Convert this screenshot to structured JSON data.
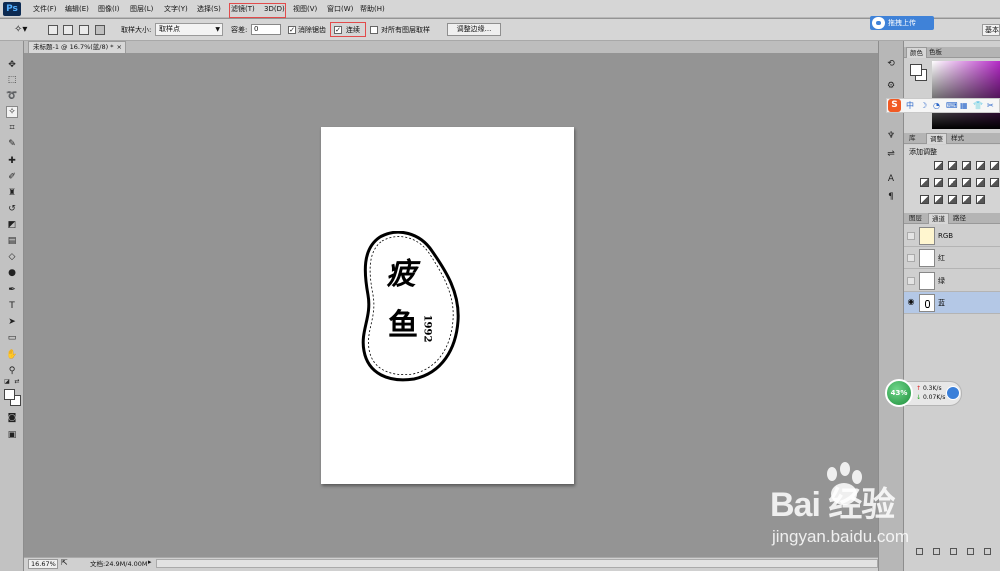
{
  "app": {
    "logo": "Ps"
  },
  "menu": [
    {
      "label": "文件(F)"
    },
    {
      "label": "编辑(E)"
    },
    {
      "label": "图像(I)"
    },
    {
      "label": "图层(L)"
    },
    {
      "label": "文字(Y)"
    },
    {
      "label": "选择(S)"
    },
    {
      "label": "滤镜(T)"
    },
    {
      "label": "3D(D)"
    },
    {
      "label": "视图(V)"
    },
    {
      "label": "窗口(W)"
    },
    {
      "label": "帮助(H)"
    }
  ],
  "upload_button": "拖拽上传",
  "options": {
    "sample_size_label": "取样大小:",
    "sample_size_value": "取样点",
    "tolerance_label": "容差:",
    "tolerance_value": "0",
    "antialias_label": "消除锯齿",
    "contiguous_label": "连续",
    "sample_all_label": "对所有图层取样",
    "refine_edge_label": "调整边缘...",
    "workspace_label": "基本"
  },
  "document_tab": {
    "title": "未标题-1 @ 16.7%(蓝/8) *",
    "close": "×"
  },
  "canvas": {
    "line1": "疲",
    "line2": "鱼",
    "year": "1992"
  },
  "status": {
    "zoom": "16.67%",
    "doc_info": "文档:24.9M/4.00M"
  },
  "panels": {
    "color_tabs": [
      "颜色",
      "色板"
    ],
    "adjust_tabs": [
      "库",
      "调整",
      "样式"
    ],
    "adjust_title": "添加调整",
    "layer_tabs": [
      "图层",
      "通道",
      "路径"
    ],
    "channels": [
      {
        "name": "RGB",
        "visible": false,
        "selected": false
      },
      {
        "name": "红",
        "visible": false,
        "selected": false
      },
      {
        "name": "绿",
        "visible": false,
        "selected": false
      },
      {
        "name": "蓝",
        "visible": true,
        "selected": true
      }
    ]
  },
  "ime": {
    "label": "S",
    "glyphs": [
      "中",
      "☽",
      "◔",
      "⌨",
      "▦",
      "👕",
      "✂"
    ]
  },
  "net": {
    "percent": "43%",
    "up": "0.3K/s",
    "down": "0.07K/s"
  },
  "watermark": {
    "logo": "Bai 经验",
    "url": "jingyan.baidu.com"
  },
  "colors": {
    "accent": "#3f82d8",
    "highlight_box": "#e24b4b",
    "selected_channel": "#b4c8e6"
  }
}
